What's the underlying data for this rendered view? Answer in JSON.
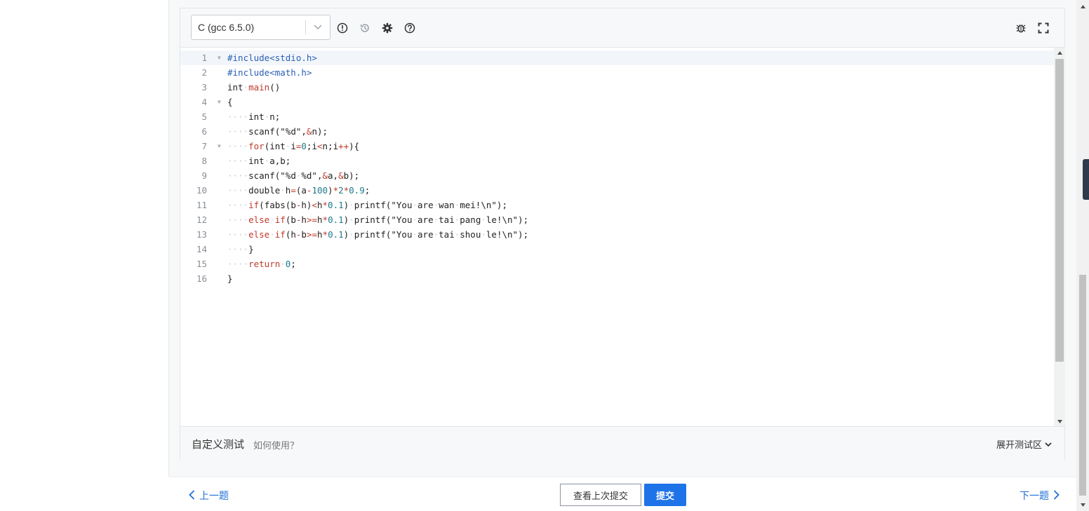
{
  "editor": {
    "language": "C (gcc 6.5.0)",
    "toolbar_icons": [
      "info-icon",
      "history-icon",
      "settings-icon",
      "help-icon",
      "debug-icon",
      "fullscreen-icon"
    ]
  },
  "code_lines": [
    {
      "num": "1",
      "fold": true,
      "html": "<span class=\"tok-pre\">#include&lt;stdio.h&gt;</span>"
    },
    {
      "num": "2",
      "fold": false,
      "html": "<span class=\"tok-pre\">#include&lt;math.h&gt;</span>"
    },
    {
      "num": "3",
      "fold": false,
      "html": "int<span class=\"ws\">·</span><span class=\"tok-fn\">main</span>()"
    },
    {
      "num": "4",
      "fold": true,
      "html": "{"
    },
    {
      "num": "5",
      "fold": false,
      "html": "<span class=\"ws\">····</span>int<span class=\"ws\">·</span>n;"
    },
    {
      "num": "6",
      "fold": false,
      "html": "<span class=\"ws\">····</span>scanf(\"%d\",<span class=\"tok-op\">&amp;</span>n);"
    },
    {
      "num": "7",
      "fold": true,
      "html": "<span class=\"ws\">····</span><span class=\"tok-kw\">for</span>(int<span class=\"ws\">·</span>i<span class=\"tok-op\">=</span><span class=\"tok-num\">0</span>;i<span class=\"tok-op\">&lt;</span>n;i<span class=\"tok-op\">++</span>){"
    },
    {
      "num": "8",
      "fold": false,
      "html": "<span class=\"ws\">····</span>int<span class=\"ws\">·</span>a,b;"
    },
    {
      "num": "9",
      "fold": false,
      "html": "<span class=\"ws\">····</span>scanf(\"%d<span class=\"ws\">·</span>%d\",<span class=\"tok-op\">&amp;</span>a,<span class=\"tok-op\">&amp;</span>b);"
    },
    {
      "num": "10",
      "fold": false,
      "html": "<span class=\"ws\">····</span>double<span class=\"ws\">·</span>h<span class=\"tok-op\">=</span>(a<span class=\"tok-op\">-</span><span class=\"tok-num\">100</span>)<span class=\"tok-op\">*</span><span class=\"tok-num\">2</span><span class=\"tok-op\">*</span><span class=\"tok-num\">0.9</span>;"
    },
    {
      "num": "11",
      "fold": false,
      "html": "<span class=\"ws\">····</span><span class=\"tok-kw\">if</span>(fabs(b<span class=\"tok-op\">-</span>h)<span class=\"tok-op\">&lt;</span>h<span class=\"tok-op\">*</span><span class=\"tok-num\">0.1</span>)<span class=\"ws\">·</span>printf(\"You<span class=\"ws\">·</span>are<span class=\"ws\">·</span>wan<span class=\"ws\">·</span>mei!\\n\");"
    },
    {
      "num": "12",
      "fold": false,
      "html": "<span class=\"ws\">····</span><span class=\"tok-kw\">else</span><span class=\"ws\">·</span><span class=\"tok-kw\">if</span>(b<span class=\"tok-op\">-</span>h<span class=\"tok-op\">&gt;=</span>h<span class=\"tok-op\">*</span><span class=\"tok-num\">0.1</span>)<span class=\"ws\">·</span>printf(\"You<span class=\"ws\">·</span>are<span class=\"ws\">·</span>tai<span class=\"ws\">·</span>pang<span class=\"ws\">·</span>le!\\n\");"
    },
    {
      "num": "13",
      "fold": false,
      "html": "<span class=\"ws\">····</span><span class=\"tok-kw\">else</span><span class=\"ws\">·</span><span class=\"tok-kw\">if</span>(h<span class=\"tok-op\">-</span>b<span class=\"tok-op\">&gt;=</span>h<span class=\"tok-op\">*</span><span class=\"tok-num\">0.1</span>)<span class=\"ws\">·</span>printf(\"You<span class=\"ws\">·</span>are<span class=\"ws\">·</span>tai<span class=\"ws\">·</span>shou<span class=\"ws\">·</span>le!\\n\");"
    },
    {
      "num": "14",
      "fold": false,
      "html": "<span class=\"ws\">····</span>}"
    },
    {
      "num": "15",
      "fold": false,
      "html": "<span class=\"ws\">····</span><span class=\"tok-kw\">return</span><span class=\"ws\">·</span><span class=\"tok-num\">0</span>;"
    },
    {
      "num": "16",
      "fold": false,
      "html": "}"
    }
  ],
  "test": {
    "title": "自定义测试",
    "help": "如何使用？",
    "expand": "展开测试区"
  },
  "nav": {
    "prev": "上一题",
    "next": "下一题",
    "view_last": "查看上次提交",
    "submit": "提交"
  },
  "colors": {
    "accent": "#1f73e8",
    "link": "#1f6fd6"
  }
}
